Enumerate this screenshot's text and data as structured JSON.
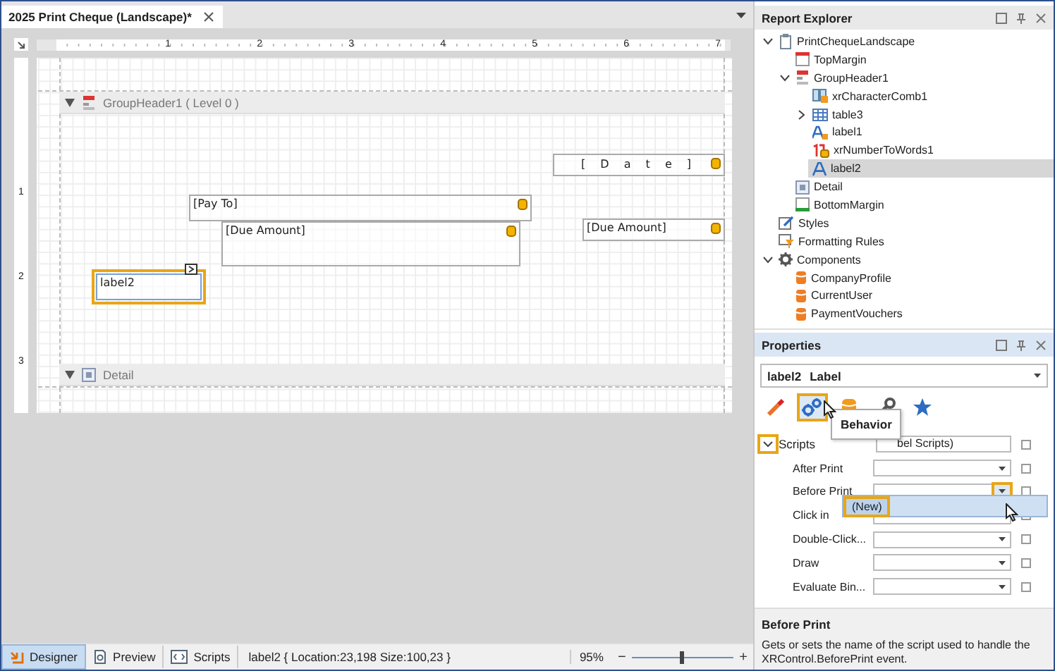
{
  "document_tab": {
    "title": "2025 Print Cheque (Landscape)*",
    "selected": true
  },
  "rulers": {
    "horizontal": [
      "1",
      "2",
      "3",
      "4",
      "5",
      "6",
      "7"
    ],
    "vertical": [
      "1",
      "2",
      "3"
    ]
  },
  "bands": [
    {
      "kind": "group-header",
      "name": "GroupHeader1 ( Level 0 )",
      "expanded": true
    },
    {
      "kind": "detail",
      "name": "Detail",
      "expanded": true
    }
  ],
  "controls": [
    {
      "kind": "comb",
      "text": "[ D a t e ]",
      "bound": true,
      "selected": false,
      "highlighted": false
    },
    {
      "kind": "label",
      "text": "[Pay To]",
      "bound": true,
      "selected": false,
      "highlighted": false
    },
    {
      "kind": "label",
      "text": "[Due Amount]",
      "bound": true,
      "selected": false,
      "highlighted": false
    },
    {
      "kind": "label",
      "text": "[Due Amount]",
      "bound": true,
      "selected": false,
      "highlighted": false
    },
    {
      "kind": "label",
      "text": "label2",
      "bound": false,
      "selected": true,
      "highlighted": true
    }
  ],
  "explorer": {
    "title": "Report Explorer",
    "items": [
      {
        "label": "PrintChequeLandscape",
        "kind": "report",
        "selected": false,
        "expanded": true,
        "children": [
          {
            "label": "TopMargin",
            "kind": "top-margin",
            "selected": false
          },
          {
            "label": "GroupHeader1",
            "kind": "group-header",
            "selected": false,
            "expanded": true,
            "children": [
              {
                "label": "xrCharacterComb1",
                "kind": "comb",
                "selected": false
              },
              {
                "label": "table3",
                "kind": "table",
                "selected": false,
                "expanded": false
              },
              {
                "label": "label1",
                "kind": "bound-label",
                "selected": false
              },
              {
                "label": "xrNumberToWords1",
                "kind": "number-words",
                "selected": false
              },
              {
                "label": "label2",
                "kind": "label",
                "selected": true
              }
            ]
          },
          {
            "label": "Detail",
            "kind": "detail",
            "selected": false
          },
          {
            "label": "BottomMargin",
            "kind": "bottom-margin",
            "selected": false
          }
        ]
      },
      {
        "label": "Styles",
        "kind": "styles",
        "selected": false
      },
      {
        "label": "Formatting Rules",
        "kind": "rules",
        "selected": false
      },
      {
        "label": "Components",
        "kind": "components",
        "selected": false,
        "expanded": true,
        "children": [
          {
            "label": "CompanyProfile",
            "kind": "datasource",
            "selected": false
          },
          {
            "label": "CurrentUser",
            "kind": "datasource",
            "selected": false
          },
          {
            "label": "PaymentVouchers",
            "kind": "datasource",
            "selected": false
          }
        ]
      }
    ]
  },
  "properties": {
    "title": "Properties",
    "object_name": "label2",
    "object_type": "Label",
    "tabs": [
      {
        "kind": "pen",
        "selected": false,
        "highlighted": false
      },
      {
        "kind": "behavior",
        "selected": true,
        "highlighted": true
      },
      {
        "kind": "data",
        "selected": false,
        "highlighted": false
      },
      {
        "kind": "wrench",
        "selected": false,
        "highlighted": false
      },
      {
        "kind": "star",
        "selected": false,
        "highlighted": false
      }
    ],
    "tooltip": "Behavior",
    "rows": [
      {
        "kind": "category",
        "label": "Scripts",
        "value": "bel Scripts)",
        "expanded": true,
        "highlighted": true
      },
      {
        "kind": "dropdown",
        "label": "After Print",
        "open": false
      },
      {
        "kind": "dropdown",
        "label": "Before Print",
        "open": true
      },
      {
        "kind": "dropdown",
        "label": "Click in",
        "open": false
      },
      {
        "kind": "dropdown",
        "label": "Double-Click...",
        "open": false
      },
      {
        "kind": "dropdown",
        "label": "Draw",
        "open": false
      },
      {
        "kind": "dropdown",
        "label": "Evaluate Bin...",
        "open": false
      }
    ],
    "dropdown_items": [
      {
        "text": "(New)",
        "selected": true,
        "highlighted": true
      }
    ],
    "description": {
      "title": "Before Print",
      "text": "Gets or sets the name of the script used to handle the XRControl.BeforePrint event."
    }
  },
  "status_bar": {
    "views": [
      {
        "label": "Designer",
        "kind": "designer",
        "selected": true
      },
      {
        "label": "Preview",
        "kind": "preview",
        "selected": false
      },
      {
        "label": "Scripts",
        "kind": "scripts",
        "selected": false
      }
    ],
    "info": "label2 { Location:23,198 Size:100,23 }",
    "zoom": "95%",
    "level": 0.48,
    "zoom_out": "−",
    "zoom_in": "+"
  }
}
